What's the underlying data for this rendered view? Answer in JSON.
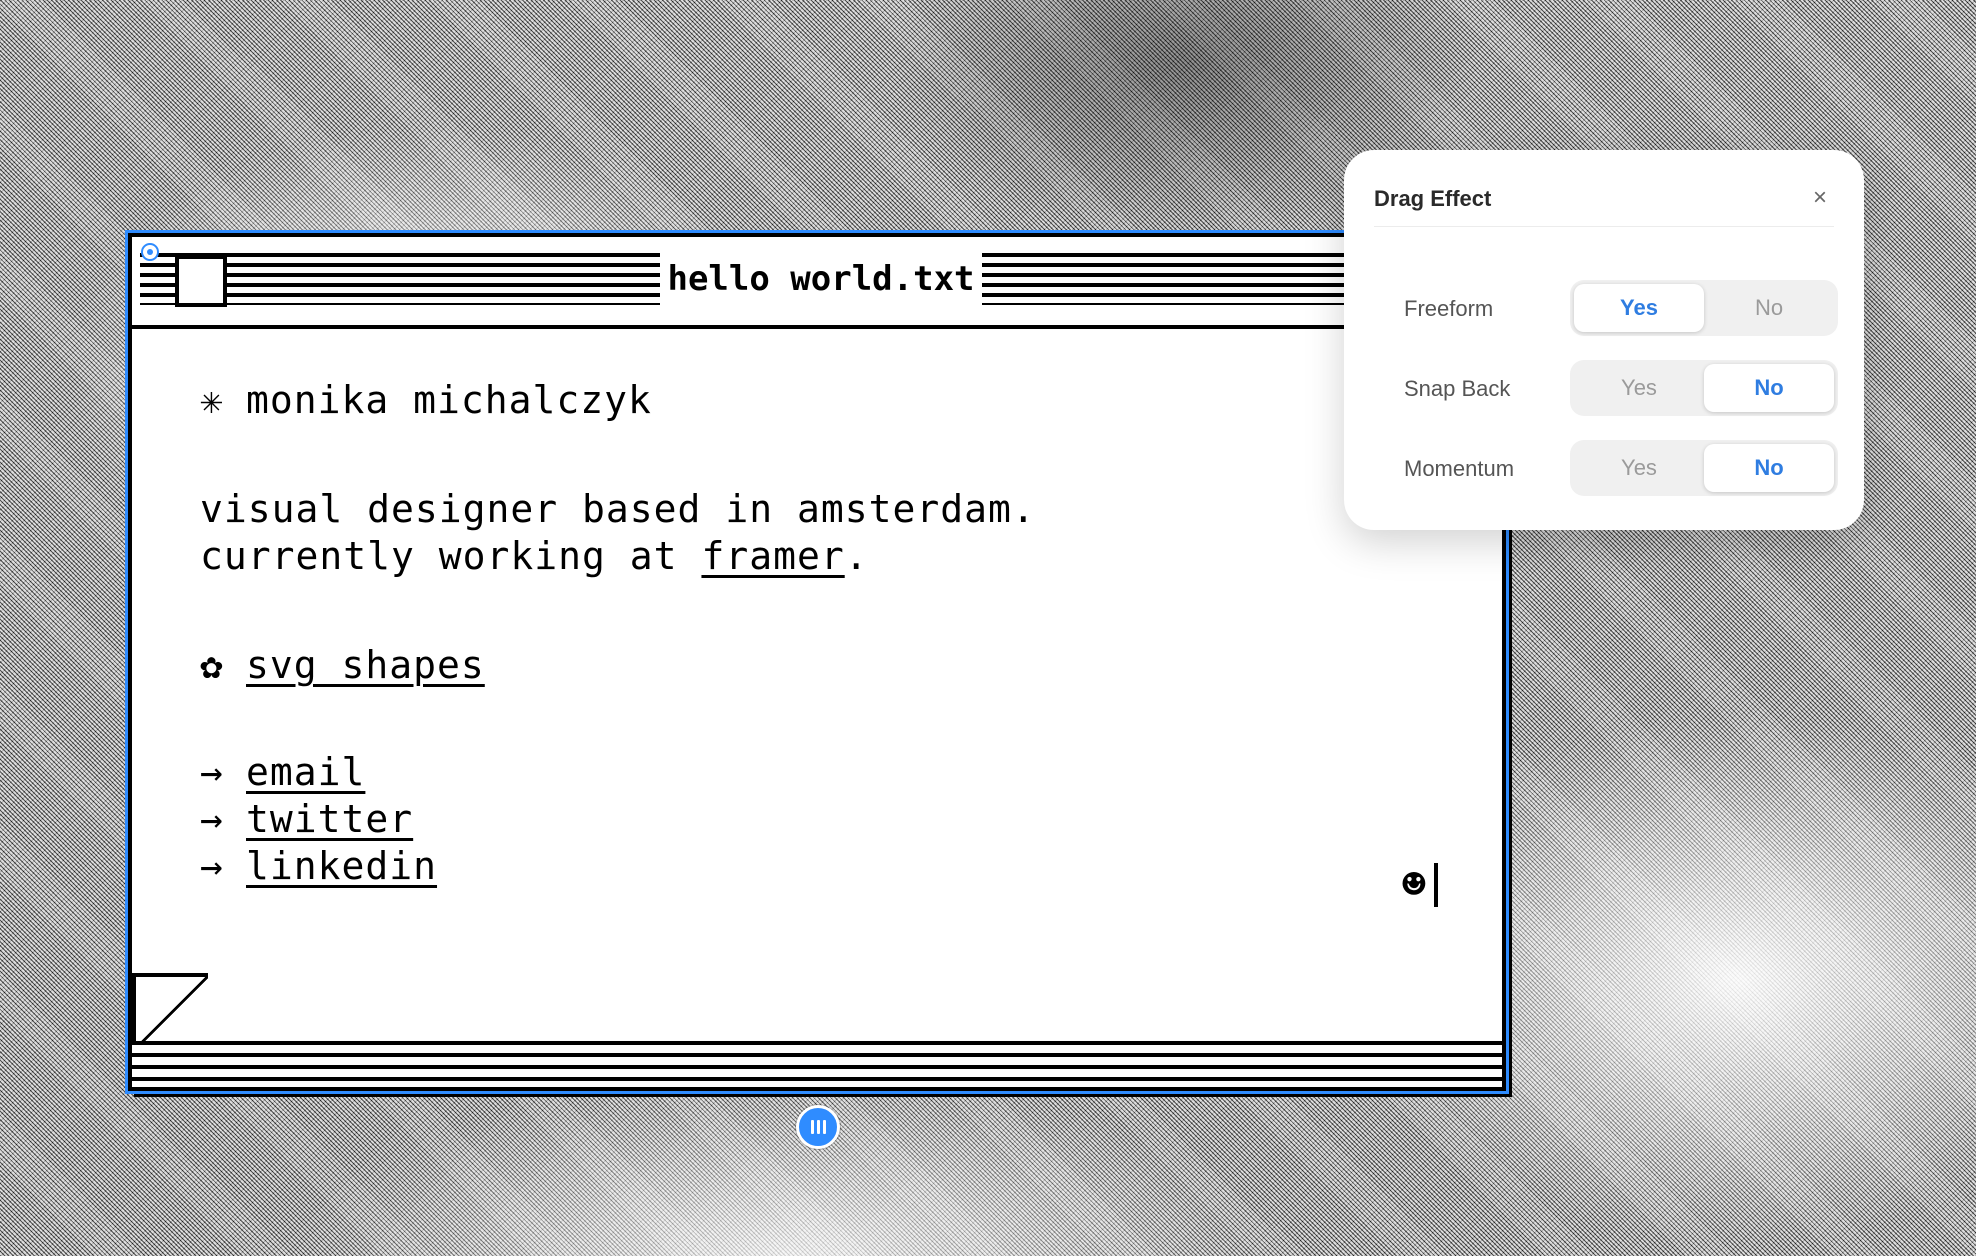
{
  "window": {
    "title": "hello world.txt",
    "name_glyph": "✳",
    "name": "monika michalczyk",
    "bio_line1": "visual designer based in amsterdam.",
    "bio_line2_prefix": "currently working at ",
    "bio_link": "framer",
    "bio_line2_suffix": ".",
    "shapes_glyph": "✿",
    "shapes_link": "svg shapes",
    "arrow": "→",
    "links": [
      "email",
      "twitter",
      "linkedin"
    ],
    "smiley": "☻"
  },
  "panel": {
    "title": "Drag Effect",
    "close": "×",
    "rows": [
      {
        "label": "Freeform",
        "yes": "Yes",
        "no": "No",
        "selected": "Yes"
      },
      {
        "label": "Snap Back",
        "yes": "Yes",
        "no": "No",
        "selected": "No"
      },
      {
        "label": "Momentum",
        "yes": "Yes",
        "no": "No",
        "selected": "No"
      }
    ]
  },
  "colors": {
    "accent": "#2f8cff",
    "segment_selected_text": "#2f7de1"
  }
}
